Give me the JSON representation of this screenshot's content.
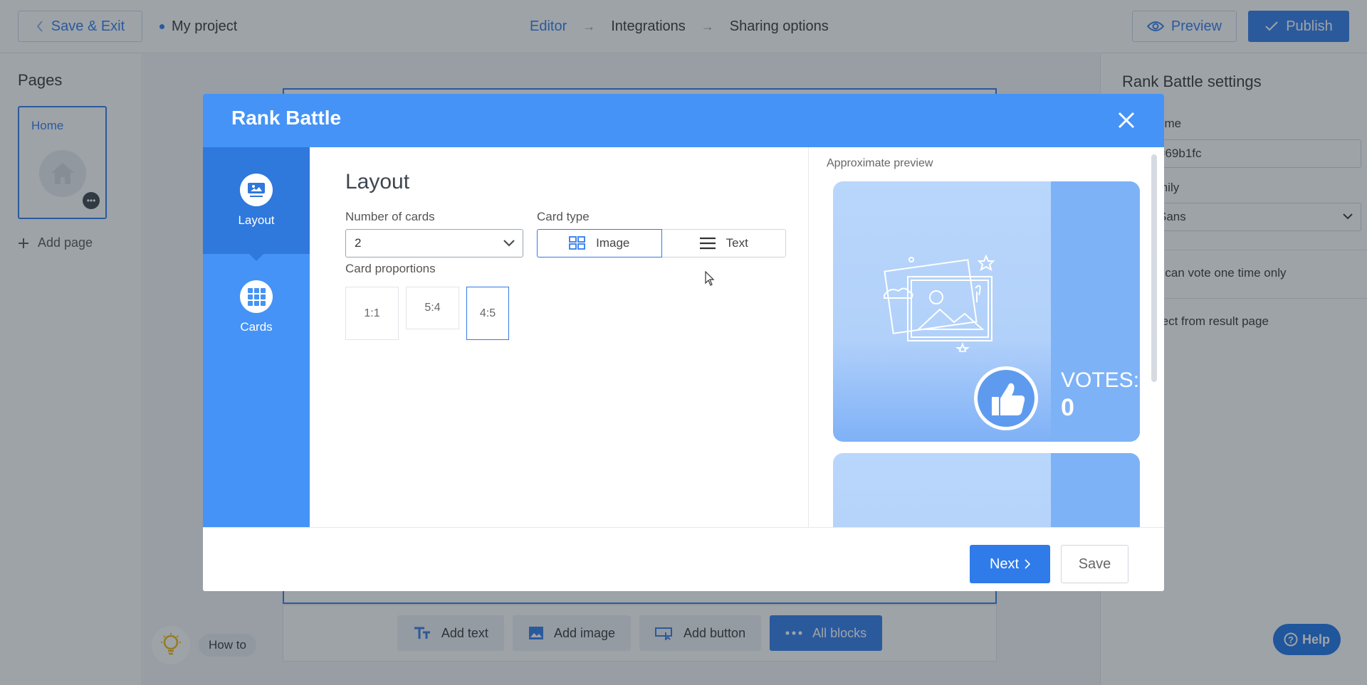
{
  "topbar": {
    "save_exit": "Save & Exit",
    "project_name": "My project",
    "steps": [
      "Editor",
      "Integrations",
      "Sharing options"
    ],
    "preview": "Preview",
    "publish": "Publish"
  },
  "left_panel": {
    "title": "Pages",
    "page_label": "Home",
    "add_page": "Add page"
  },
  "canvas": {
    "blocks": [
      "Add text",
      "Add image",
      "Add button",
      "All blocks"
    ],
    "how_to": "How to"
  },
  "right_panel": {
    "title": "Rank Battle settings",
    "theme_label": "eme",
    "theme_value": "#69b1fc",
    "family_label": "mily",
    "family_value": "Sans",
    "vote_text": "r can vote one time only",
    "redirect_text": "rect from result page"
  },
  "help": "Help",
  "modal": {
    "title": "Rank Battle",
    "tabs": [
      "Layout",
      "Cards"
    ],
    "section_title": "Layout",
    "num_cards_label": "Number of cards",
    "num_cards_value": "2",
    "card_type_label": "Card type",
    "card_types": [
      "Image",
      "Text"
    ],
    "card_type_selected": "Image",
    "proportions_label": "Card proportions",
    "proportions": [
      "1:1",
      "5:4",
      "4:5"
    ],
    "proportion_selected": "4:5",
    "preview_label": "Approximate preview",
    "votes_label": "VOTES:",
    "votes_value": "0",
    "next": "Next",
    "save": "Save"
  },
  "colors": {
    "accent": "#2f7bea",
    "modal_header": "#4593f6",
    "theme": "#69b1fc"
  }
}
